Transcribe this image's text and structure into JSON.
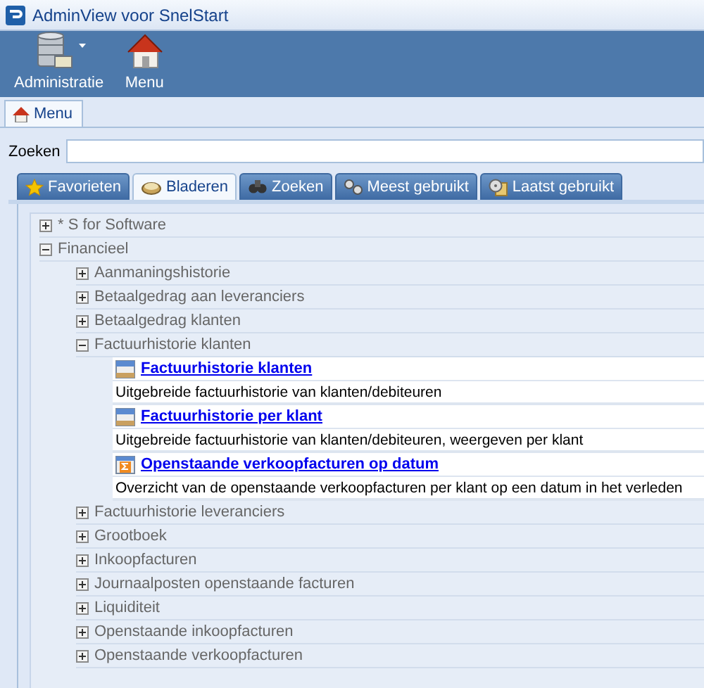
{
  "window": {
    "title": "AdminView voor SnelStart"
  },
  "toolbar": [
    {
      "label": "Administratie",
      "kind": "database",
      "dropdown": true
    },
    {
      "label": "Menu",
      "kind": "house",
      "dropdown": false
    }
  ],
  "doc_tabs": [
    {
      "label": "Menu",
      "selected": true
    }
  ],
  "search": {
    "label": "Zoeken"
  },
  "tabs": [
    {
      "label": "Favorieten",
      "kind": "star",
      "selected": false
    },
    {
      "label": "Bladeren",
      "kind": "soap",
      "selected": true
    },
    {
      "label": "Zoeken",
      "kind": "binoculars",
      "selected": false
    },
    {
      "label": "Meest gebruikt",
      "kind": "pins",
      "selected": false
    },
    {
      "label": "Laatst gebruikt",
      "kind": "disk",
      "selected": false
    }
  ],
  "tree": [
    {
      "kind": "group",
      "label": "* S for Software",
      "expanded": false
    },
    {
      "kind": "group",
      "label": "Financieel",
      "expanded": true,
      "children": [
        {
          "kind": "group",
          "label": "Aanmaningshistorie",
          "expanded": false
        },
        {
          "kind": "group",
          "label": "Betaalgedrag aan leveranciers",
          "expanded": false
        },
        {
          "kind": "group",
          "label": "Betaalgedrag klanten",
          "expanded": false
        },
        {
          "kind": "group",
          "label": "Factuurhistorie klanten",
          "expanded": true,
          "children": [
            {
              "kind": "table_report",
              "title": "Factuurhistorie klanten",
              "description": "Uitgebreide factuurhistorie van klanten/debiteuren"
            },
            {
              "kind": "table_report",
              "title": "Factuurhistorie per klant",
              "description": "Uitgebreide factuurhistorie van klanten/debiteuren, weergeven per klant"
            },
            {
              "kind": "sum_report",
              "title": "Openstaande verkoopfacturen op datum",
              "description": "Overzicht van de openstaande verkoopfacturen per klant op een datum in het verleden"
            }
          ]
        },
        {
          "kind": "group",
          "label": "Factuurhistorie leveranciers",
          "expanded": false
        },
        {
          "kind": "group",
          "label": "Grootboek",
          "expanded": false
        },
        {
          "kind": "group",
          "label": "Inkoopfacturen",
          "expanded": false
        },
        {
          "kind": "group",
          "label": "Journaalposten openstaande facturen",
          "expanded": false
        },
        {
          "kind": "group",
          "label": "Liquiditeit",
          "expanded": false
        },
        {
          "kind": "group",
          "label": "Openstaande inkoopfacturen",
          "expanded": false
        },
        {
          "kind": "group",
          "label": "Openstaande verkoopfacturen",
          "expanded": false
        }
      ]
    }
  ]
}
